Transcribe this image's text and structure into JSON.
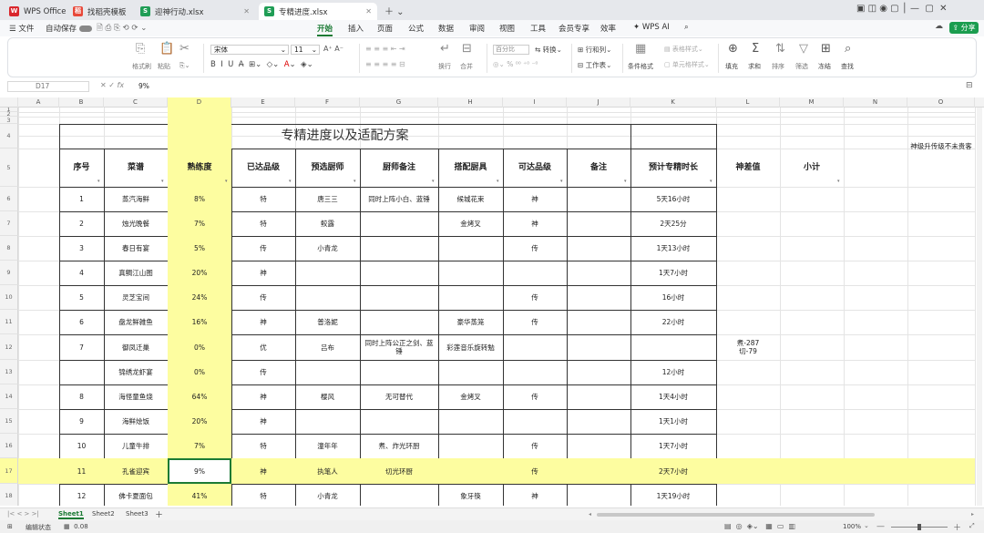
{
  "tabs": {
    "wps": "WPS Office",
    "t1": "找稻壳模板",
    "t2": "迎神行动.xlsx",
    "t3": "专精进度.xlsx"
  },
  "menubar": {
    "file": "文件",
    "autosave": "自动保存",
    "items": [
      "开始",
      "插入",
      "页面",
      "公式",
      "数据",
      "审阅",
      "视图",
      "工具",
      "会员专享",
      "效率"
    ],
    "wpsai": "WPS AI",
    "share": "分享"
  },
  "ribbon": {
    "font": "宋体",
    "size": "11",
    "labels": [
      "格式刷",
      "粘贴",
      "百分比",
      "转换",
      "换行",
      "合并",
      "行和列",
      "工作表",
      "条件格式",
      "表格样式",
      "单元格样式",
      "填充",
      "求和",
      "排序",
      "筛选",
      "冻结",
      "查找"
    ]
  },
  "formula": {
    "cell": "D17",
    "value": "9%"
  },
  "columns": [
    "A",
    "B",
    "C",
    "D",
    "E",
    "F",
    "G",
    "H",
    "I",
    "J",
    "K",
    "L",
    "M",
    "N",
    "O"
  ],
  "table": {
    "title": "专精进度以及适配方案",
    "headers": [
      "序号",
      "菜谱",
      "熟练度",
      "已达品级",
      "预选厨师",
      "厨师备注",
      "搭配厨具",
      "可达品级",
      "备注",
      "预计专精时长",
      "神差值",
      "小计"
    ],
    "side_note": "神级升传级不未贵客",
    "rows": [
      {
        "r": "6",
        "cells": [
          "1",
          "蒸汽海鲜",
          "8%",
          "特",
          "唐三三",
          "同时上阵小白、蓝锤",
          "候城花束",
          "神",
          "",
          "5天16小时",
          ""
        ]
      },
      {
        "r": "7",
        "cells": [
          "2",
          "烛光晚餐",
          "7%",
          "特",
          "鲛露",
          "",
          "金烤叉",
          "神",
          "",
          "2天25分",
          ""
        ]
      },
      {
        "r": "8",
        "cells": [
          "3",
          "春日有宴",
          "5%",
          "传",
          "小青龙",
          "",
          "",
          "传",
          "",
          "1天13小时",
          ""
        ]
      },
      {
        "r": "9",
        "cells": [
          "4",
          "真鲷江山图",
          "20%",
          "神",
          "",
          "",
          "",
          "",
          "",
          "1天7小时",
          ""
        ]
      },
      {
        "r": "10",
        "cells": [
          "5",
          "灵芝宝间",
          "24%",
          "传",
          "",
          "",
          "",
          "传",
          "",
          "16小时",
          ""
        ]
      },
      {
        "r": "11",
        "cells": [
          "6",
          "盘龙鲜雑鱼",
          "16%",
          "神",
          "普洛妮",
          "",
          "豪华蒸笼",
          "传",
          "",
          "22小时",
          ""
        ]
      },
      {
        "r": "12",
        "cells": [
          "7",
          "御凤迁巢",
          "0%",
          "优",
          "吕布",
          "同时上阵公正之剑、蓝锤",
          "彩莲音乐旋转勉",
          "",
          "",
          "",
          "煮-287\n切-79"
        ]
      },
      {
        "r": "13",
        "cells": [
          "",
          "锦绣龙虾宴",
          "0%",
          "传",
          "",
          "",
          "",
          "",
          "",
          "12小时",
          ""
        ]
      },
      {
        "r": "14",
        "cells": [
          "8",
          "海怪童鱼烧",
          "64%",
          "神",
          "樱风",
          "无可替代",
          "金烤叉",
          "传",
          "",
          "1天4小时",
          ""
        ]
      },
      {
        "r": "15",
        "cells": [
          "9",
          "海鲜烩饭",
          "20%",
          "神",
          "",
          "",
          "",
          "",
          "",
          "1天1小时",
          ""
        ]
      },
      {
        "r": "16",
        "cells": [
          "10",
          "儿童牛排",
          "7%",
          "特",
          "潼年年",
          "煮、炸光环厨",
          "",
          "传",
          "",
          "1天7小时",
          ""
        ]
      },
      {
        "r": "17",
        "cells": [
          "11",
          "孔雀迎宾",
          "9%",
          "神",
          "执笔人",
          "切光环厨",
          "",
          "传",
          "",
          "2天7小时",
          ""
        ]
      },
      {
        "r": "18",
        "cells": [
          "12",
          "佛卡夏面包",
          "41%",
          "特",
          "小青龙",
          "",
          "象牙筷",
          "神",
          "",
          "1天19小时",
          ""
        ]
      }
    ]
  },
  "sheets": [
    "Sheet1",
    "Sheet2",
    "Sheet3"
  ],
  "status": {
    "mode": "编辑状态",
    "sum": "0.08",
    "zoom": "100%"
  },
  "colors": {
    "highlight": "#fdfda0",
    "accent": "#1b7a34"
  }
}
